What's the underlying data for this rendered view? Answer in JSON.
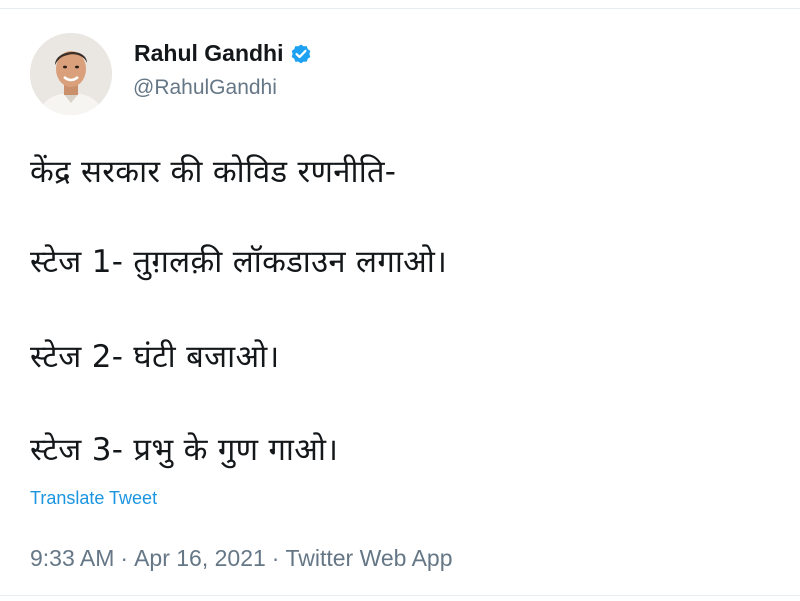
{
  "author": {
    "name": "Rahul Gandhi",
    "handle": "@RahulGandhi",
    "verified_icon": "verified-badge-icon"
  },
  "tweet": {
    "lines": [
      "केंद्र सरकार की कोविड रणनीति-",
      "स्टेज 1- तुग़लक़ी लॉकडाउन लगाओ।",
      "स्टेज 2- घंटी बजाओ।",
      "स्टेज 3- प्रभु के गुण गाओ।"
    ],
    "translate_label": "Translate Tweet"
  },
  "meta": {
    "time": "9:33 AM",
    "separator": "·",
    "date": "Apr 16, 2021",
    "source": "Twitter Web App"
  },
  "colors": {
    "link_blue": "#1b95e0",
    "secondary_text": "#657786",
    "primary_text": "#14171a",
    "verified_blue": "#1da1f2"
  }
}
